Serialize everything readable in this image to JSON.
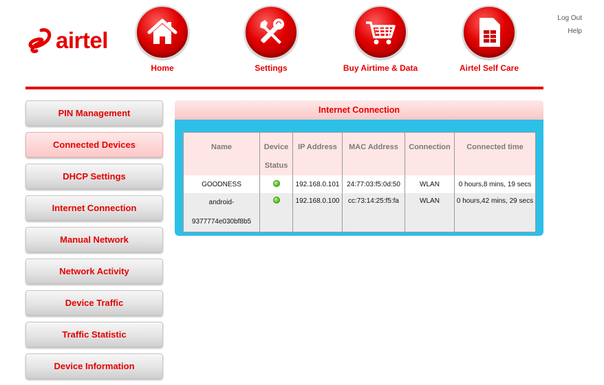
{
  "brand": {
    "name": "airtel",
    "color": "#e40000"
  },
  "nav": [
    {
      "label": "Home",
      "icon": "home-icon"
    },
    {
      "label": "Settings",
      "icon": "settings-tools-icon"
    },
    {
      "label": "Buy Airtime & Data",
      "icon": "shopping-cart-icon"
    },
    {
      "label": "Airtel Self Care",
      "icon": "sim-card-icon"
    }
  ],
  "top_links": {
    "logout": "Log Out",
    "help": "Help"
  },
  "sidebar": {
    "items": [
      {
        "label": "PIN Management",
        "active": false
      },
      {
        "label": "Connected Devices",
        "active": true
      },
      {
        "label": "DHCP Settings",
        "active": false
      },
      {
        "label": "Internet Connection",
        "active": false
      },
      {
        "label": "Manual Network",
        "active": false
      },
      {
        "label": "Network Activity",
        "active": false
      },
      {
        "label": "Device Traffic",
        "active": false
      },
      {
        "label": "Traffic Statistic",
        "active": false
      },
      {
        "label": "Device Information",
        "active": false
      }
    ]
  },
  "panel": {
    "title": "Internet Connection",
    "columns": [
      "Name",
      "Device Status",
      "IP Address",
      "MAC Address",
      "Connection",
      "Connected time"
    ],
    "rows": [
      {
        "name": "GOODNESS",
        "status": "online",
        "ip": "192.168.0.101",
        "mac": "24:77:03:f5:0d:50",
        "connection": "WLAN",
        "time": "0 hours,8 mins, 19 secs"
      },
      {
        "name_line1": "android-",
        "name_line2": "9377774e030bf8b5",
        "status": "online",
        "ip": "192.168.0.100",
        "mac": "cc:73:14:25:f5:fa",
        "connection": "WLAN",
        "time": "0 hours,42 mins, 29 secs"
      }
    ]
  },
  "colors": {
    "accent": "#e40000",
    "panel_bg": "#2ebfe7",
    "status_online": "#5cc82a"
  }
}
